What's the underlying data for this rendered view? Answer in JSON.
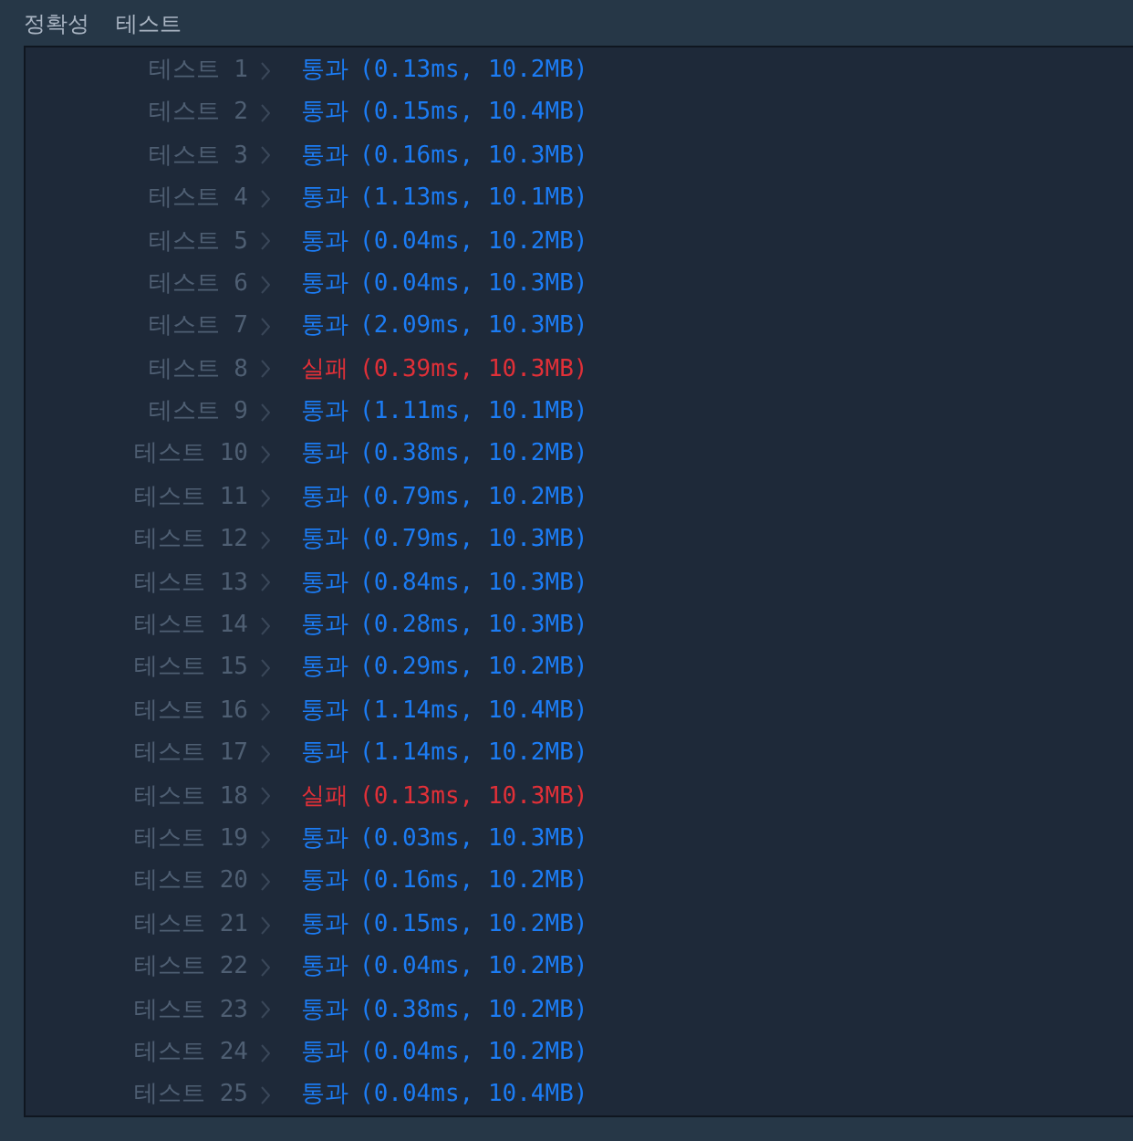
{
  "header": {
    "title": "정확성  테스트"
  },
  "tests": [
    {
      "label": "테스트 1",
      "status": "통과",
      "detail": "(0.13ms, 10.2MB)",
      "failed": false
    },
    {
      "label": "테스트 2",
      "status": "통과",
      "detail": "(0.15ms, 10.4MB)",
      "failed": false
    },
    {
      "label": "테스트 3",
      "status": "통과",
      "detail": "(0.16ms, 10.3MB)",
      "failed": false
    },
    {
      "label": "테스트 4",
      "status": "통과",
      "detail": "(1.13ms, 10.1MB)",
      "failed": false
    },
    {
      "label": "테스트 5",
      "status": "통과",
      "detail": "(0.04ms, 10.2MB)",
      "failed": false
    },
    {
      "label": "테스트 6",
      "status": "통과",
      "detail": "(0.04ms, 10.3MB)",
      "failed": false
    },
    {
      "label": "테스트 7",
      "status": "통과",
      "detail": "(2.09ms, 10.3MB)",
      "failed": false
    },
    {
      "label": "테스트 8",
      "status": "실패",
      "detail": "(0.39ms, 10.3MB)",
      "failed": true
    },
    {
      "label": "테스트 9",
      "status": "통과",
      "detail": "(1.11ms, 10.1MB)",
      "failed": false
    },
    {
      "label": "테스트 10",
      "status": "통과",
      "detail": "(0.38ms, 10.2MB)",
      "failed": false
    },
    {
      "label": "테스트 11",
      "status": "통과",
      "detail": "(0.79ms, 10.2MB)",
      "failed": false
    },
    {
      "label": "테스트 12",
      "status": "통과",
      "detail": "(0.79ms, 10.3MB)",
      "failed": false
    },
    {
      "label": "테스트 13",
      "status": "통과",
      "detail": "(0.84ms, 10.3MB)",
      "failed": false
    },
    {
      "label": "테스트 14",
      "status": "통과",
      "detail": "(0.28ms, 10.3MB)",
      "failed": false
    },
    {
      "label": "테스트 15",
      "status": "통과",
      "detail": "(0.29ms, 10.2MB)",
      "failed": false
    },
    {
      "label": "테스트 16",
      "status": "통과",
      "detail": "(1.14ms, 10.4MB)",
      "failed": false
    },
    {
      "label": "테스트 17",
      "status": "통과",
      "detail": "(1.14ms, 10.2MB)",
      "failed": false
    },
    {
      "label": "테스트 18",
      "status": "실패",
      "detail": "(0.13ms, 10.3MB)",
      "failed": true
    },
    {
      "label": "테스트 19",
      "status": "통과",
      "detail": "(0.03ms, 10.3MB)",
      "failed": false
    },
    {
      "label": "테스트 20",
      "status": "통과",
      "detail": "(0.16ms, 10.2MB)",
      "failed": false
    },
    {
      "label": "테스트 21",
      "status": "통과",
      "detail": "(0.15ms, 10.2MB)",
      "failed": false
    },
    {
      "label": "테스트 22",
      "status": "통과",
      "detail": "(0.04ms, 10.2MB)",
      "failed": false
    },
    {
      "label": "테스트 23",
      "status": "통과",
      "detail": "(0.38ms, 10.2MB)",
      "failed": false
    },
    {
      "label": "테스트 24",
      "status": "통과",
      "detail": "(0.04ms, 10.2MB)",
      "failed": false
    },
    {
      "label": "테스트 25",
      "status": "통과",
      "detail": "(0.04ms, 10.4MB)",
      "failed": false
    }
  ]
}
